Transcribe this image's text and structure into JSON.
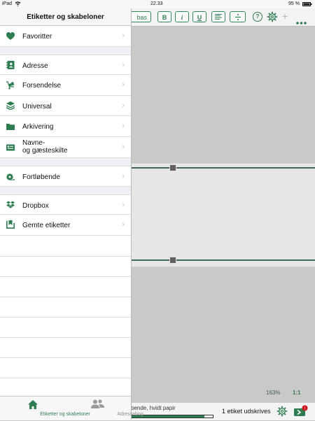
{
  "status_bar": {
    "carrier": "iPad",
    "time": "22.33",
    "battery": "95 %"
  },
  "panel": {
    "title": "Etiketter og skabeloner",
    "items": [
      {
        "label": "Favoritter",
        "icon": "heart-icon"
      },
      {
        "label": "Adresse",
        "icon": "address-book-icon"
      },
      {
        "label": "Forsendelse",
        "icon": "shipping-icon"
      },
      {
        "label": "Universal",
        "icon": "layers-icon"
      },
      {
        "label": "Arkivering",
        "icon": "folder-icon"
      },
      {
        "label": "Navne-\nog gæsteskilte",
        "icon": "name-badge-icon"
      },
      {
        "label": "Fortløbende",
        "icon": "tape-roll-icon"
      },
      {
        "label": "Dropbox",
        "icon": "dropbox-icon"
      },
      {
        "label": "Gemte etiketter",
        "icon": "saved-labels-icon"
      }
    ]
  },
  "tabs": [
    {
      "label": "Etiketter og skabeloner",
      "icon": "home-icon",
      "active": true
    },
    {
      "label": "Adressebog",
      "icon": "people-icon",
      "active": false
    }
  ],
  "toolbar": {
    "font_button_fragment": "bas",
    "bold": "B",
    "italic": "i",
    "underline": "U",
    "help": "?",
    "add": "+"
  },
  "main": {
    "zoom": "163%",
    "ratio": "1:1"
  },
  "bottom_bar": {
    "paper": "bende, hvidt papir",
    "print_count": "1 etiket udskrives",
    "progress": 0.9
  },
  "colors": {
    "accent": "#2e7d50",
    "canvas": "#c9c9c9",
    "label": "#e6e6e6"
  }
}
